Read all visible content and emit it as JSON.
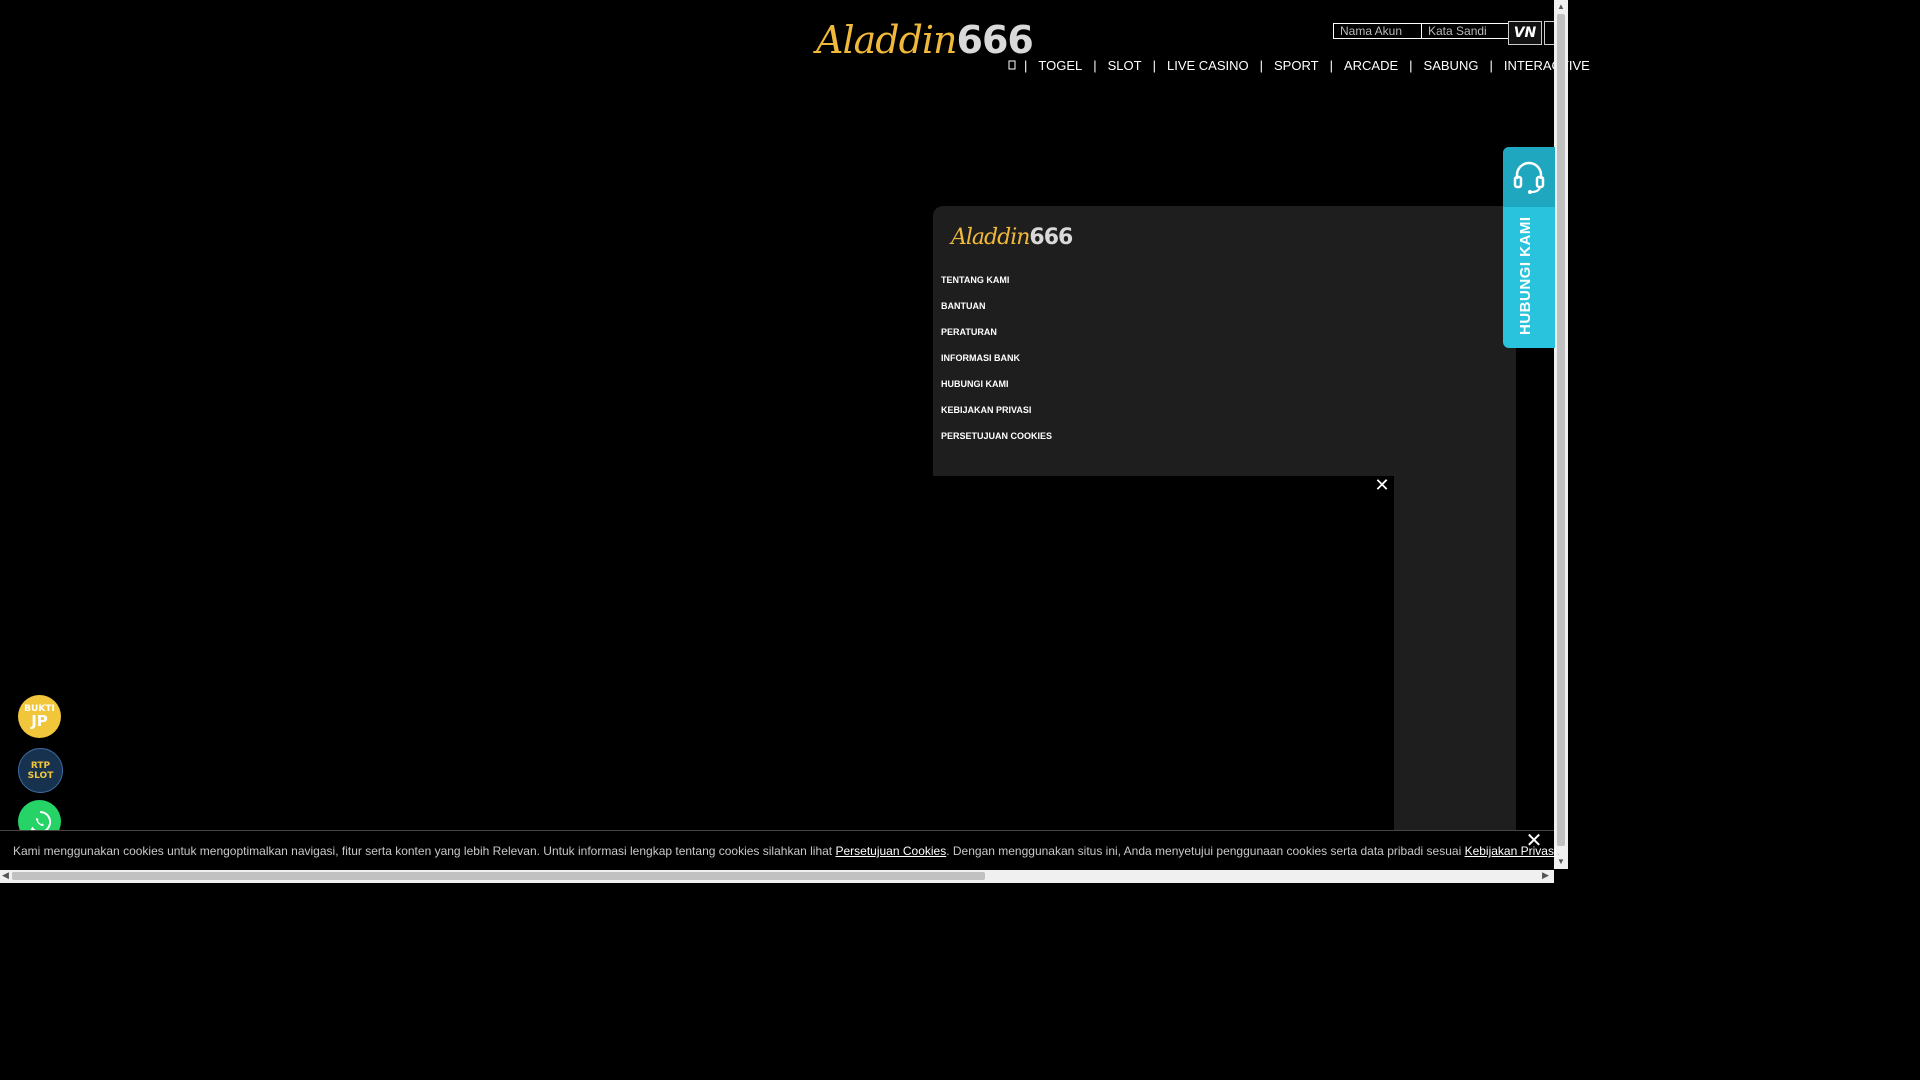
{
  "header": {
    "logo_script": "Aladdin",
    "logo_number": "666",
    "login": {
      "username_placeholder": "Nama Akun",
      "password_placeholder": "Kata Sandi"
    },
    "language_badge": "VN"
  },
  "nav": {
    "home_icon": "home-icon",
    "items": [
      "TOGEL",
      "SLOT",
      "LIVE CASINO",
      "SPORT",
      "ARCADE",
      "SABUNG",
      "INTERACTIVE"
    ],
    "separator": "|"
  },
  "footer": {
    "logo_script": "Aladdin",
    "logo_number": "666",
    "links": [
      "TENTANG KAMI",
      "BANTUAN",
      "PERATURAN",
      "INFORMASI BANK",
      "HUBUNGI KAMI",
      "KEBIJAKAN PRIVASI",
      "PERSETUJUAN COOKIES"
    ]
  },
  "contact_tab": {
    "label": "HUBUNGI KAMI",
    "icon": "headset-icon",
    "color": "#29c3dd"
  },
  "floating": {
    "bukti": {
      "line1": "BUKTI",
      "line2": "JP"
    },
    "rtp": {
      "line1": "RTP",
      "line2": "SLOT"
    },
    "whatsapp_icon": "whatsapp-icon"
  },
  "cookie": {
    "text_before": "Kami menggunakan cookies untuk mengoptimalkan navigasi, fitur serta konten yang lebih Relevan. Untuk informasi lengkap tentang cookies silahkan lihat ",
    "link1": "Persetujuan Cookies",
    "text_middle": ". Dengan menggunakan situs ini, Anda menyetujui penggunaan cookies serta data pribadi sesuai ",
    "link2": "Kebijakan Privasi",
    "text_after": "."
  },
  "colors": {
    "brand_gold": "#f0b93a",
    "background": "#000000",
    "panel": "#1e1e1e"
  }
}
